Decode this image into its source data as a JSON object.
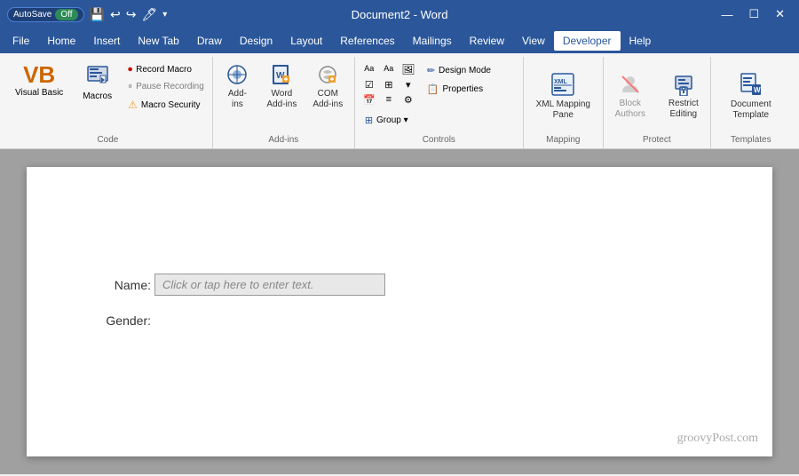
{
  "titlebar": {
    "autosave_label": "AutoSave",
    "toggle_label": "Off",
    "title": "Document2 - Word",
    "window_controls": [
      "—",
      "☐",
      "✕"
    ]
  },
  "menubar": {
    "items": [
      {
        "label": "File",
        "active": false
      },
      {
        "label": "Home",
        "active": false
      },
      {
        "label": "Insert",
        "active": false
      },
      {
        "label": "New Tab",
        "active": false
      },
      {
        "label": "Draw",
        "active": false
      },
      {
        "label": "Design",
        "active": false
      },
      {
        "label": "Layout",
        "active": false
      },
      {
        "label": "References",
        "active": false
      },
      {
        "label": "Mailings",
        "active": false
      },
      {
        "label": "Review",
        "active": false
      },
      {
        "label": "View",
        "active": false
      },
      {
        "label": "Developer",
        "active": true
      },
      {
        "label": "Help",
        "active": false
      }
    ]
  },
  "ribbon": {
    "groups": [
      {
        "id": "code",
        "label": "Code",
        "items": {
          "visual_basic": "Visual\nBasic",
          "macros": "Macros",
          "record_macro": "Record Macro",
          "pause_recording": "Pause Recording",
          "macro_security": "Macro Security"
        }
      },
      {
        "id": "addins",
        "label": "Add-ins",
        "items": {
          "addins": "Add-\nins",
          "word_addins": "Word\nAdd-ins",
          "com_addins": "COM\nAdd-ins"
        }
      },
      {
        "id": "controls",
        "label": "Controls",
        "items": {
          "design_mode": "Design Mode",
          "properties": "Properties",
          "group": "⊞ Group ▾"
        }
      },
      {
        "id": "mapping",
        "label": "Mapping",
        "items": {
          "xml_mapping_pane": "XML Mapping\nPane"
        }
      },
      {
        "id": "protect",
        "label": "Protect",
        "items": {
          "block_authors": "Block\nAuthors",
          "restrict_editing": "Restrict\nEditing"
        }
      },
      {
        "id": "templates",
        "label": "Templates",
        "items": {
          "document_template": "Document\nTemplate"
        }
      }
    ]
  },
  "document": {
    "name_label": "Name:",
    "name_placeholder": "Click or tap here to enter text.",
    "gender_label": "Gender:",
    "watermark": "groovyPost.com"
  }
}
